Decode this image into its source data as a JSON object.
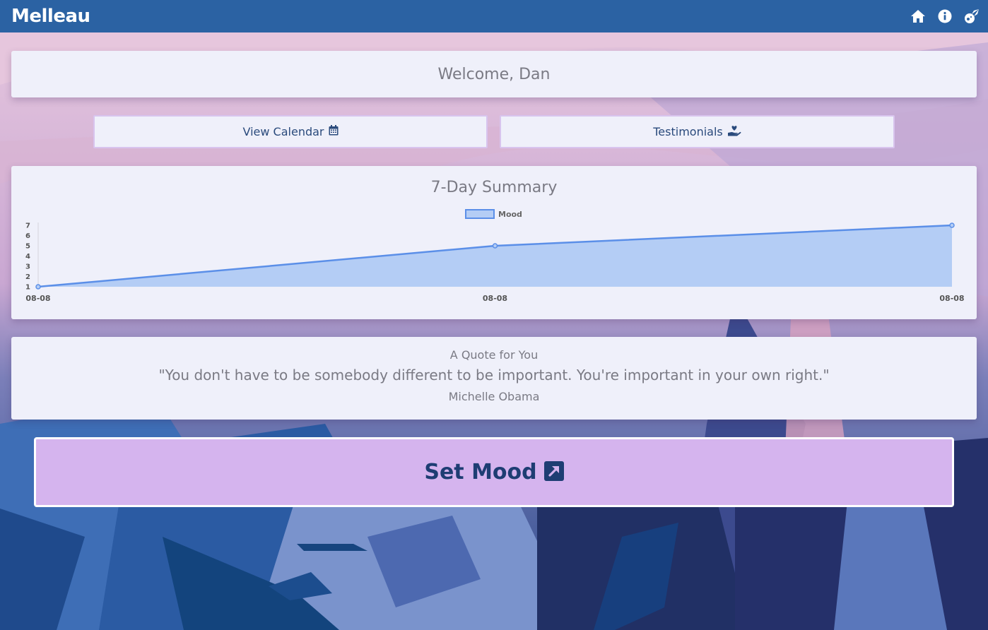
{
  "navbar": {
    "brand": "Melleau",
    "icons": [
      "home-icon",
      "info-icon",
      "meteor-icon"
    ]
  },
  "welcome": {
    "text": "Welcome, Dan"
  },
  "buttons": {
    "calendar_label": "View Calendar",
    "calendar_icon": "calendar-icon",
    "testimonials_label": "Testimonials",
    "testimonials_icon": "hand-heart-icon"
  },
  "summary": {
    "title": "7-Day Summary"
  },
  "chart_data": {
    "type": "area",
    "title": "7-Day Summary",
    "x": [
      "08-08",
      "08-08",
      "08-08"
    ],
    "series": [
      {
        "name": "Mood",
        "values": [
          1,
          5,
          7
        ],
        "color": "#5b8fe8",
        "fill": "#b4cdf5"
      }
    ],
    "yticks": [
      1,
      2,
      3,
      4,
      5,
      6,
      7
    ],
    "ylim": [
      1,
      7
    ],
    "legend": "top-center",
    "grid": false
  },
  "quote": {
    "heading": "A Quote for You",
    "text": "\"You don't have to be somebody different to be important. You're important in your own right.\"",
    "author": "Michelle Obama"
  },
  "set_mood": {
    "label": "Set Mood",
    "icon": "external-link-square-icon"
  },
  "colors": {
    "navbar": "#2b62a3",
    "card": "#eff0fa",
    "set_mood_bg": "#d5b4ee",
    "accent_text": "#1e3d73"
  }
}
